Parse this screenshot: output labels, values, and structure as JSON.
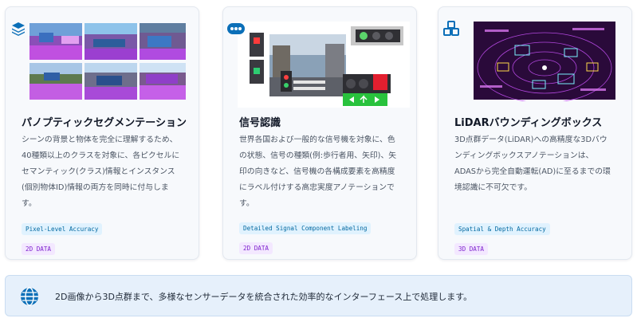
{
  "cards": [
    {
      "icon": "layers-icon",
      "title": "パノプティックセグメンテーション",
      "desc": "シーンの背景と物体を完全に理解するため、40種類以上のクラスを対象に、各ピクセルにセマンティック(クラス)情報とインスタンス(個別物体ID)情報の両方を同時に付与します。",
      "tags": [
        {
          "label": "Pixel-Level Accuracy",
          "style": "blue"
        },
        {
          "label": "2D DATA",
          "style": "purple"
        }
      ]
    },
    {
      "icon": "dots-icon",
      "title": "信号認識",
      "desc": "世界各国および一般的な信号機を対象に、色の状態、信号の種類(例:歩行者用、矢印)、矢印の向きなど、信号機の各構成要素を高精度にラベル付けする高忠実度アノテーションです。",
      "tags": [
        {
          "label": "Detailed Signal Component Labeling",
          "style": "blue"
        },
        {
          "label": "2D DATA",
          "style": "purple"
        }
      ]
    },
    {
      "icon": "cubes-icon",
      "title": "LiDARバウンディングボックス",
      "desc": "3D点群データ(LiDAR)への高精度な3Dバウンディングボックスアノテーションは、ADASから完全自動運転(AD)に至るまでの環境認識に不可欠です。",
      "tags": [
        {
          "label": "Spatial & Depth Accuracy",
          "style": "blue"
        },
        {
          "label": "3D DATA",
          "style": "purple"
        }
      ]
    }
  ],
  "banner": {
    "icon": "globe-icon",
    "text": "2D画像から3D点群まで、多様なセンサーデータを統合された効率的なインターフェース上で処理します。"
  },
  "colors": {
    "accent": "#0b6fb8",
    "segmentation": "#b04be0",
    "lidar_bg": "#2a0a3a"
  }
}
